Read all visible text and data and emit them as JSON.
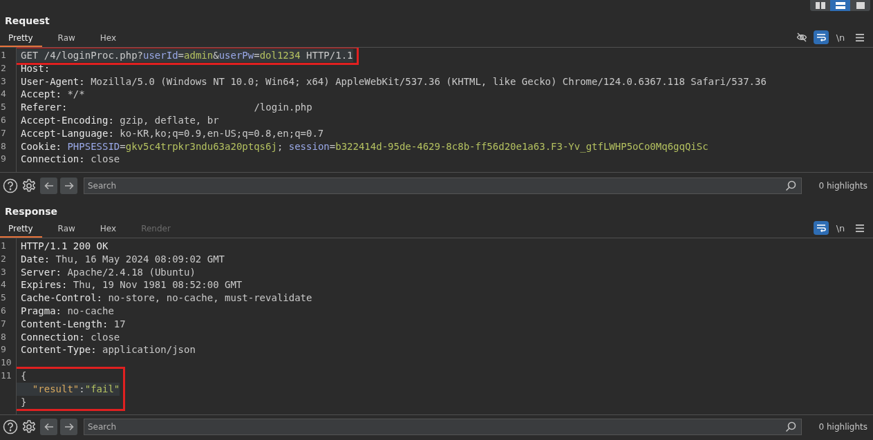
{
  "layout_buttons": [
    {
      "kind": "columns",
      "selected": false
    },
    {
      "kind": "rows",
      "selected": true
    },
    {
      "kind": "single",
      "selected": false
    }
  ],
  "panes": [
    {
      "title": "Request",
      "tabs": [
        {
          "label": "Pretty",
          "selected": true,
          "disabled": false
        },
        {
          "label": "Raw",
          "selected": false,
          "disabled": false
        },
        {
          "label": "Hex",
          "selected": false,
          "disabled": false
        }
      ],
      "tools": [
        {
          "kind": "eye-off",
          "on": false
        },
        {
          "kind": "wrap",
          "on": true
        },
        {
          "kind": "text",
          "label": "\\n",
          "on": false
        },
        {
          "kind": "menu",
          "on": false
        }
      ],
      "lines": [
        {
          "number": "1",
          "highlighted": true,
          "boxed": true,
          "segments": [
            {
              "kind": "text",
              "text": "GET /4/loginProc.php?"
            },
            {
              "kind": "param",
              "text": "userId"
            },
            {
              "kind": "text",
              "text": "="
            },
            {
              "kind": "value",
              "text": "admin"
            },
            {
              "kind": "text",
              "text": "&"
            },
            {
              "kind": "param",
              "text": "userPw"
            },
            {
              "kind": "text",
              "text": "="
            },
            {
              "kind": "value",
              "text": "dol1234"
            },
            {
              "kind": "text",
              "text": " HTTP/1.1"
            }
          ]
        },
        {
          "number": "2",
          "highlighted": false,
          "boxed": false,
          "segments": [
            {
              "kind": "name",
              "text": "Host:"
            }
          ]
        },
        {
          "number": "3",
          "highlighted": false,
          "boxed": false,
          "segments": [
            {
              "kind": "name",
              "text": "User-Agent:"
            },
            {
              "kind": "text",
              "text": " Mozilla/5.0 (Windows NT 10.0; Win64; x64) AppleWebKit/537.36 (KHTML, like Gecko) Chrome/124.0.6367.118 Safari/537.36"
            }
          ]
        },
        {
          "number": "4",
          "highlighted": false,
          "boxed": false,
          "segments": [
            {
              "kind": "name",
              "text": "Accept:"
            },
            {
              "kind": "text",
              "text": " */*"
            }
          ]
        },
        {
          "number": "5",
          "highlighted": false,
          "boxed": false,
          "segments": [
            {
              "kind": "name",
              "text": "Referer:"
            },
            {
              "kind": "blank"
            },
            {
              "kind": "text",
              "text": "/login.php"
            }
          ]
        },
        {
          "number": "6",
          "highlighted": false,
          "boxed": false,
          "segments": [
            {
              "kind": "name",
              "text": "Accept-Encoding:"
            },
            {
              "kind": "text",
              "text": " gzip, deflate, br"
            }
          ]
        },
        {
          "number": "7",
          "highlighted": false,
          "boxed": false,
          "segments": [
            {
              "kind": "name",
              "text": "Accept-Language:"
            },
            {
              "kind": "text",
              "text": " ko-KR,ko;q=0.9,en-US;q=0.8,en;q=0.7"
            }
          ]
        },
        {
          "number": "8",
          "highlighted": false,
          "boxed": false,
          "segments": [
            {
              "kind": "name",
              "text": "Cookie:"
            },
            {
              "kind": "space"
            },
            {
              "kind": "param",
              "text": "PHPSESSID"
            },
            {
              "kind": "text",
              "text": "="
            },
            {
              "kind": "value",
              "text": "gkv5c4trpkr3ndu63a20ptqs6j"
            },
            {
              "kind": "text",
              "text": "; "
            },
            {
              "kind": "param",
              "text": "session"
            },
            {
              "kind": "text",
              "text": "="
            },
            {
              "kind": "value",
              "text": "b322414d-95de-4629-8c8b-ff56d20e1a63.F3-Yv_gtfLWHP5oCo0Mq6gqQiSc"
            }
          ]
        },
        {
          "number": "9",
          "highlighted": false,
          "boxed": false,
          "segments": [
            {
              "kind": "name",
              "text": "Connection:"
            },
            {
              "kind": "text",
              "text": " close"
            }
          ]
        }
      ],
      "search": {
        "placeholder": "Search"
      },
      "highlights": "0 highlights"
    },
    {
      "title": "Response",
      "tabs": [
        {
          "label": "Pretty",
          "selected": true,
          "disabled": false
        },
        {
          "label": "Raw",
          "selected": false,
          "disabled": false
        },
        {
          "label": "Hex",
          "selected": false,
          "disabled": false
        },
        {
          "label": "Render",
          "selected": false,
          "disabled": true
        }
      ],
      "tools": [
        {
          "kind": "wrap",
          "on": true
        },
        {
          "kind": "text",
          "label": "\\n",
          "on": false
        },
        {
          "kind": "menu",
          "on": false
        }
      ],
      "lines": [
        {
          "number": "1",
          "highlighted": false,
          "boxed": false,
          "segments": [
            {
              "kind": "name",
              "text": "HTTP/1.1 200 OK"
            }
          ]
        },
        {
          "number": "2",
          "highlighted": false,
          "boxed": false,
          "segments": [
            {
              "kind": "name",
              "text": "Date:"
            },
            {
              "kind": "text",
              "text": " Thu, 16 May 2024 08:09:02 GMT"
            }
          ]
        },
        {
          "number": "3",
          "highlighted": false,
          "boxed": false,
          "segments": [
            {
              "kind": "name",
              "text": "Server:"
            },
            {
              "kind": "text",
              "text": " Apache/2.4.18 (Ubuntu)"
            }
          ]
        },
        {
          "number": "4",
          "highlighted": false,
          "boxed": false,
          "segments": [
            {
              "kind": "name",
              "text": "Expires:"
            },
            {
              "kind": "text",
              "text": " Thu, 19 Nov 1981 08:52:00 GMT"
            }
          ]
        },
        {
          "number": "5",
          "highlighted": false,
          "boxed": false,
          "segments": [
            {
              "kind": "name",
              "text": "Cache-Control:"
            },
            {
              "kind": "text",
              "text": " no-store, no-cache, must-revalidate"
            }
          ]
        },
        {
          "number": "6",
          "highlighted": false,
          "boxed": false,
          "segments": [
            {
              "kind": "name",
              "text": "Pragma:"
            },
            {
              "kind": "text",
              "text": " no-cache"
            }
          ]
        },
        {
          "number": "7",
          "highlighted": false,
          "boxed": false,
          "segments": [
            {
              "kind": "name",
              "text": "Content-Length:"
            },
            {
              "kind": "text",
              "text": " 17"
            }
          ]
        },
        {
          "number": "8",
          "highlighted": false,
          "boxed": false,
          "segments": [
            {
              "kind": "name",
              "text": "Connection:"
            },
            {
              "kind": "text",
              "text": " close"
            }
          ]
        },
        {
          "number": "9",
          "highlighted": false,
          "boxed": false,
          "segments": [
            {
              "kind": "name",
              "text": "Content-Type:"
            },
            {
              "kind": "text",
              "text": " application/json"
            }
          ]
        },
        {
          "number": "10",
          "highlighted": false,
          "boxed": false
        },
        {
          "number": "11",
          "highlighted": false,
          "boxed": true,
          "segments": [
            {
              "kind": "text",
              "text": "{"
            }
          ]
        },
        {
          "highlighted": true,
          "boxed": true,
          "segments": [
            {
              "kind": "indent"
            },
            {
              "kind": "jkey",
              "text": "\"result\""
            },
            {
              "kind": "text",
              "text": ":"
            },
            {
              "kind": "value",
              "text": "\"fail\""
            }
          ]
        },
        {
          "highlighted": false,
          "boxed": true,
          "segments": [
            {
              "kind": "text",
              "text": "}"
            }
          ]
        }
      ],
      "search": {
        "placeholder": "Search"
      },
      "highlights": "0 highlights"
    }
  ]
}
